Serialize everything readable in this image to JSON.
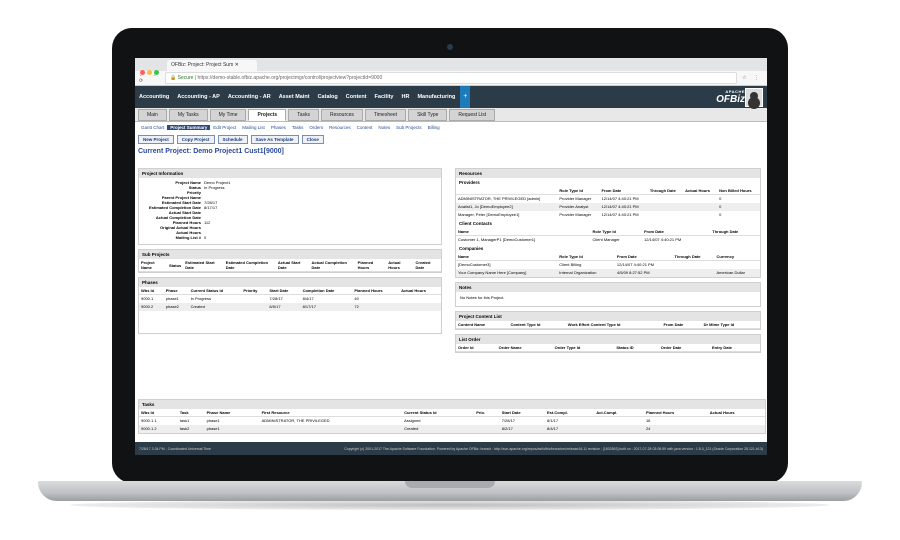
{
  "browser": {
    "tab_title": "OFBiz: Project: Project Sum",
    "secure_label": "Secure",
    "url": "https://demo-stable.ofbiz.apache.org/projectmgr/control/projectview?projectId=9000"
  },
  "menu": [
    "Accounting",
    "Accounting - AP",
    "Accounting - AR",
    "Asset Maint",
    "Catalog",
    "Content",
    "Facility",
    "HR",
    "Manufacturing"
  ],
  "menu_plus": "+",
  "logo": {
    "brand": "OFBiz",
    "company": "APACHE"
  },
  "app_tabs": [
    "Main",
    "My Tasks",
    "My Time",
    "Projects",
    "Tasks",
    "Resources",
    "Timesheet",
    "Skill Type",
    "Request List"
  ],
  "sub_links": [
    "Gantt Chart",
    "Project Summary",
    "Edit Project",
    "Mailing List",
    "Phases",
    "Tasks",
    "Orders",
    "Resources",
    "Content",
    "Notes",
    "Sub Projects",
    "Billing"
  ],
  "buttons": [
    "New Project",
    "Copy Project",
    "Schedule",
    "Save As Template",
    "Close"
  ],
  "current_project": "Current Project: Demo Project1 Cust1[9000]",
  "project_info": {
    "title": "Project Information",
    "rows": [
      {
        "k": "Project Name",
        "v": "Demo Project1"
      },
      {
        "k": "Status",
        "v": "In Progress"
      },
      {
        "k": "Priority",
        "v": ""
      },
      {
        "k": "Parent Project Name",
        "v": ""
      },
      {
        "k": "Estimated Start Date",
        "v": "7/28/17"
      },
      {
        "k": "Estimated Completion Date",
        "v": "8/17/17"
      },
      {
        "k": "Actual Start Date",
        "v": ""
      },
      {
        "k": "Actual Completion Date",
        "v": ""
      },
      {
        "k": "Planned Hours",
        "v": "112"
      },
      {
        "k": "Original Actual Hours",
        "v": ""
      },
      {
        "k": "Actual Hours",
        "v": ""
      },
      {
        "k": "Mailing List #",
        "v": "0"
      }
    ]
  },
  "sub_projects": {
    "title": "Sub Projects",
    "headers": [
      "Project Name",
      "Status",
      "Estimated Start Date",
      "Estimated Completion Date",
      "Actual Start Date",
      "Actual Completion Date",
      "Planned Hours",
      "Actual Hours",
      "Created Date"
    ]
  },
  "phases": {
    "title": "Phases",
    "headers": [
      "Wbs Id",
      "Phase",
      "Current Status Id",
      "Priority",
      "Start Date",
      "Completion Date",
      "Planned Hours",
      "Actual Hours"
    ],
    "rows": [
      [
        "9000.1",
        "phase1",
        "In Progress",
        "",
        "7/28/17",
        "8/4/17",
        "40",
        ""
      ],
      [
        "9000.2",
        "phase2",
        "Created",
        "",
        "8/5/17",
        "8/17/17",
        "72",
        ""
      ]
    ]
  },
  "resources": {
    "title": "Resources",
    "providers_label": "Providers",
    "providers_headers": [
      "",
      "Role Type Id",
      "From Date",
      "Through Date",
      "Actual Hours",
      "Non Billed Hours"
    ],
    "providers": [
      [
        "ADMINISTRATOR, THE PRIVILEGED [admin]",
        "Provider Manager",
        "12/14/07 4:40:21 PM",
        "",
        "",
        "0"
      ],
      [
        "Analist1, Jo [DemoEmployee2]",
        "Provider Analyst",
        "12/14/07 4:40:21 PM",
        "",
        "",
        "0"
      ],
      [
        "Manager, Peter [DemoEmployee1]",
        "Provider Manager",
        "12/14/07 4:40:21 PM",
        "",
        "",
        "0"
      ]
    ],
    "client_label": "Client Contacts",
    "client_headers": [
      "Name",
      "Role Type Id",
      "From Date",
      "Through Date"
    ],
    "clients": [
      [
        "Customer 1, ManagerP1 [DemoCustomer1]",
        "Client Manager",
        "12/14/07 4:40:21 PM",
        ""
      ]
    ],
    "companies_label": "Companies",
    "companies_headers": [
      "Name",
      "Role Type Id",
      "From Date",
      "Through Date",
      "Currency"
    ],
    "companies": [
      [
        "[DemoCustomer3]",
        "Client Billing",
        "12/14/07 4:40:21 PM",
        "",
        ""
      ],
      [
        "Your Company Name Here [Company]",
        "Internal Organization",
        "4/5/09 8:27:52 PM",
        "",
        "American Dollar"
      ]
    ]
  },
  "notes": {
    "title": "Notes",
    "text": "No Notes for this Project."
  },
  "content_list": {
    "title": "Project Content List",
    "headers": [
      "Content Name",
      "Content Type Id",
      "Work Effort Content Type Id",
      "From Date",
      "Dr Mime Type Id"
    ]
  },
  "list_order": {
    "title": "List Order",
    "headers": [
      "Order Id",
      "Order Name",
      "Order Type Id",
      "Status ID",
      "Order Date",
      "Entry Date"
    ]
  },
  "tasks": {
    "title": "Tasks",
    "headers": [
      "Wbs Id",
      "Task",
      "Phase Name",
      "First Resource",
      "Current Status Id",
      "Prio.",
      "Start Date",
      "Est.Compl.",
      "Act.Compl.",
      "Planned Hours",
      "Actual Hours"
    ],
    "rows": [
      [
        "9000.1.1",
        "task1",
        "phase1",
        "ADMINISTRATOR, THE PRIVILEGED",
        "Assigned",
        "",
        "7/28/17",
        "8/1/17",
        "",
        "16",
        ""
      ],
      [
        "9000.1.2",
        "task2",
        "phase1",
        "",
        "Created",
        "",
        "8/2/17",
        "8/4/17",
        "",
        "24",
        ""
      ]
    ]
  },
  "footer": {
    "left": "7/28/17 3:34 PM - Coordinated Universal Time",
    "right": "Copyright (c) 2001-2017 The Apache Software Foundation. Powered by Apache OFBiz. branch : http://svn.apache.org/repos/asf/ofbiz/branches/release16.11 revision : [1802893] built on : 2017-07-28 03:08:59 with java version : 1.8.0_121 (Oracle Corporation 25.121-b13)"
  },
  "colors": {
    "menubar": "#2b3b47",
    "accent": "#1e7ab8",
    "title": "#2b4a9a"
  }
}
